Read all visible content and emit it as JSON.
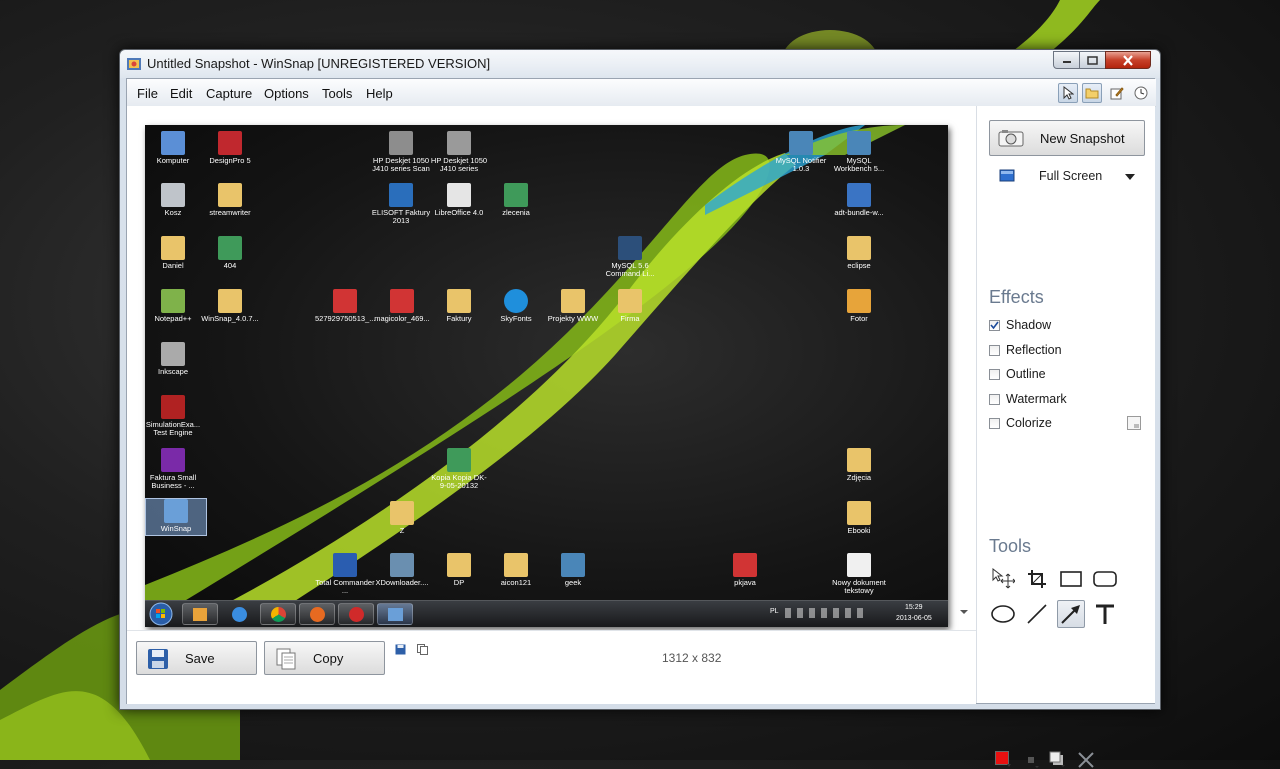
{
  "window": {
    "title": "Untitled Snapshot - WinSnap  [UNREGISTERED VERSION]"
  },
  "menu": [
    "File",
    "Edit",
    "Capture",
    "Options",
    "Tools",
    "Help"
  ],
  "snapshot": {
    "icons": [
      {
        "label": "Komputer",
        "color": "#5b8fd6"
      },
      {
        "label": "DesignPro 5",
        "color": "#c0282e"
      },
      {
        "label": "HP Deskjet 1050 J410 series Scan",
        "color": "#8d8d8d"
      },
      {
        "label": "HP Deskjet 1050 J410 series",
        "color": "#9a9a9a"
      },
      {
        "label": "MySQL Notifier 1.0.3",
        "color": "#4a86b8"
      },
      {
        "label": "MySQL Workbench 5...",
        "color": "#4a86b8"
      },
      {
        "label": "Kosz",
        "color": "#bfc4ca"
      },
      {
        "label": "streamwriter",
        "color": "#e9c46a"
      },
      {
        "label": "ELISOFT Faktury 2013",
        "color": "#2a6ebb"
      },
      {
        "label": "LibreOffice 4.0",
        "color": "#e5e5e5"
      },
      {
        "label": "zlecenia",
        "color": "#3f9a5a"
      },
      {
        "label": "adt-bundle-w...",
        "color": "#3a74c4"
      },
      {
        "label": "Daniel",
        "color": "#e9c46a"
      },
      {
        "label": "404",
        "color": "#3f9a5a"
      },
      {
        "label": "MySQL 5.6 Command Li...",
        "color": "#2c4f7a"
      },
      {
        "label": "eclipse",
        "color": "#e9c46a"
      },
      {
        "label": "Notepad++",
        "color": "#7fb24a"
      },
      {
        "label": "WinSnap_4.0.7...",
        "color": "#e9c46a"
      },
      {
        "label": "527929750513_...",
        "color": "#d13434"
      },
      {
        "label": "magicolor_469...",
        "color": "#d13434"
      },
      {
        "label": "Faktury",
        "color": "#e9c46a"
      },
      {
        "label": "SkyFonts",
        "color": "#1f8fdc"
      },
      {
        "label": "Projekty WWW",
        "color": "#e9c46a"
      },
      {
        "label": "Firma",
        "color": "#e9c46a"
      },
      {
        "label": "Fotor",
        "color": "#e7a43a"
      },
      {
        "label": "Inkscape",
        "color": "#aaaaaa"
      },
      {
        "label": "SimulationExa... Test Engine",
        "color": "#b02222"
      },
      {
        "label": "Faktura Small Business - ...",
        "color": "#7a2aa8"
      },
      {
        "label": "Kopia Kopia DK-9-05-20132",
        "color": "#3f9a5a"
      },
      {
        "label": "Zdjęcia",
        "color": "#e9c46a"
      },
      {
        "label": "WinSnap",
        "color": "#6a9fd8"
      },
      {
        "label": "Z",
        "color": "#e9c46a"
      },
      {
        "label": "Ebooki",
        "color": "#e9c46a"
      },
      {
        "label": "Total Commander ...",
        "color": "#2a5db0"
      },
      {
        "label": "XDownloader....",
        "color": "#6a8fb0"
      },
      {
        "label": "DP",
        "color": "#e9c46a"
      },
      {
        "label": "aicon121",
        "color": "#e9c46a"
      },
      {
        "label": "geek",
        "color": "#4a86b8"
      },
      {
        "label": "pkjava",
        "color": "#d13434"
      },
      {
        "label": "Nowy dokument tekstowy",
        "color": "#f0f0f0"
      }
    ],
    "tray": {
      "lang": "PL",
      "time": "15:29",
      "date": "2013-06-05"
    }
  },
  "panel": {
    "new_snapshot": "New Snapshot",
    "mode": "Full Screen",
    "effects_title": "Effects",
    "effects": [
      {
        "label": "Shadow",
        "checked": true
      },
      {
        "label": "Reflection",
        "checked": false
      },
      {
        "label": "Outline",
        "checked": false
      },
      {
        "label": "Watermark",
        "checked": false
      },
      {
        "label": "Colorize",
        "checked": false
      }
    ],
    "tools_title": "Tools",
    "color_swatch": "#e81010"
  },
  "bottom": {
    "save": "Save",
    "copy": "Copy",
    "dimensions": "1312 x 832"
  }
}
